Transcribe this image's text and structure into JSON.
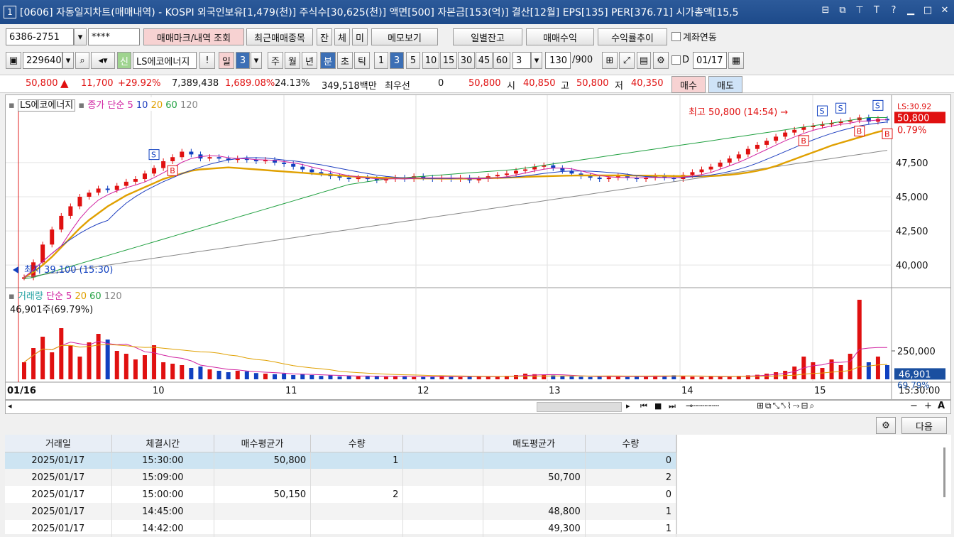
{
  "title": {
    "num": "1",
    "text": "[0606] 자동일지차트(매매내역) - KOSPI 외국인보유[1,479(천)] 주식수[30,625(천)] 액면[500] 자본금[153(억)] 결산[12월] EPS[135] PER[376.71] 시가총액[15,5"
  },
  "toolbar1": {
    "account": "6386-2751",
    "password": "****",
    "btn_trade_mark": "매매마크/내역 조회",
    "btn_recent": "최근매매종목",
    "btn_jan": "잔",
    "btn_che": "체",
    "btn_mi": "미",
    "btn_memo": "메모보기",
    "btn_daily": "일별잔고",
    "btn_profit": "매매수익",
    "btn_return": "수익률추이",
    "check_link": "계좌연동"
  },
  "toolbar2": {
    "code": "229640",
    "name": "LS에코에너지",
    "sin": "신",
    "excl": "!",
    "periods": [
      "일",
      "3",
      "주",
      "월",
      "년",
      "분",
      "초",
      "틱"
    ],
    "mins": [
      "1",
      "3",
      "5",
      "10",
      "15",
      "30",
      "45",
      "60"
    ],
    "count": "3",
    "range": "130",
    "range_total": "/900",
    "d_label": "D",
    "date": "01/17"
  },
  "quote": {
    "price": "50,800",
    "arrow": "▲",
    "change": "11,700",
    "pct": "+29.92%",
    "volume": "7,389,438",
    "vol_pct": "1,689.08%",
    "turnover": "24.13%",
    "amount": "349,518백만",
    "best": "최우선",
    "best_val": "0",
    "best_price": "50,800",
    "open_lbl": "시",
    "open": "40,850",
    "high_lbl": "고",
    "high": "50,800",
    "low_lbl": "저",
    "low": "40,350",
    "buy": "매수",
    "sell": "매도"
  },
  "chart_data": {
    "type": "line",
    "legend": {
      "name": "LS에코에너지",
      "series": "종가 단순",
      "ma": [
        "5",
        "10",
        "20",
        "60",
        "120"
      ]
    },
    "y_ticks": [
      "47,500",
      "45,000",
      "42,500",
      "40,000"
    ],
    "ylim": [
      38500,
      51500
    ],
    "x_labels": [
      "01/16",
      "10",
      "11",
      "12",
      "13",
      "14",
      "15"
    ],
    "max_label": "최고 50,800 (14:54)",
    "min_label": "최저 39,100 (15:30)",
    "price_tag": "50,800",
    "price_pct": "0.79%",
    "cut_label": "LS:30.92",
    "close": [
      39100,
      40200,
      41500,
      42600,
      43600,
      44300,
      45000,
      45300,
      45600,
      45500,
      45800,
      46100,
      46300,
      46700,
      47100,
      47600,
      47900,
      48300,
      48100,
      47800,
      47900,
      47800,
      47700,
      47800,
      47700,
      47600,
      47700,
      47500,
      47400,
      47200,
      47000,
      46800,
      46700,
      46500,
      46400,
      46300,
      46400,
      46300,
      46200,
      46300,
      46400,
      46300,
      46500,
      46400,
      46300,
      46400,
      46300,
      46400,
      46200,
      46300,
      46500,
      46600,
      46700,
      46900,
      47000,
      47200,
      47300,
      47100,
      46900,
      46700,
      46500,
      46400,
      46300,
      46400,
      46500,
      46400,
      46300,
      46400,
      46500,
      46400,
      46300,
      46600,
      46800,
      47000,
      47200,
      47500,
      47800,
      48100,
      48500,
      48800,
      49100,
      49400,
      49700,
      49900,
      50100,
      50200,
      50300,
      50400,
      50500,
      50600,
      50800,
      50500,
      50700,
      50600
    ],
    "ma20": [
      39100,
      39500,
      40000,
      40600,
      41300,
      42000,
      42700,
      43300,
      43800,
      44300,
      44700,
      45100,
      45400,
      45700,
      46000,
      46300,
      46500,
      46700,
      46900,
      47000,
      47050,
      47100,
      47150,
      47100,
      47050,
      47000,
      46950,
      46900,
      46850,
      46800,
      46750,
      46700,
      46650,
      46600,
      46550,
      46500,
      46450,
      46420,
      46400,
      46380,
      46370,
      46360,
      46350,
      46340,
      46340,
      46330,
      46330,
      46330,
      46330,
      46340,
      46360,
      46380,
      46400,
      46420,
      46450,
      46480,
      46500,
      46520,
      46540,
      46550,
      46560,
      46560,
      46560,
      46560,
      46560,
      46560,
      46550,
      46550,
      46540,
      46530,
      46520,
      46510,
      46500,
      46500,
      46520,
      46550,
      46600,
      46680,
      46780,
      46900,
      47050,
      47250,
      47500,
      47750,
      48000,
      48250,
      48500,
      48750,
      48950,
      49150,
      49350,
      49550,
      49750,
      49900
    ],
    "ma60": [
      39000,
      39100,
      39300,
      39500,
      39700,
      39900,
      40100,
      40300,
      40500,
      40700,
      40900,
      41100,
      41300,
      41500,
      41700,
      41900,
      42100,
      42300,
      42500,
      42700,
      42900,
      43100,
      43300,
      43500,
      43700,
      43900,
      44100,
      44300,
      44500,
      44700,
      44900,
      45100,
      45300,
      45500,
      45700,
      45900,
      46000,
      46100,
      46200,
      46300,
      46350,
      46400,
      46450,
      46500,
      46550,
      46600,
      46650,
      46700,
      46750,
      46800,
      46850,
      46900,
      46950,
      47000,
      47100,
      47200,
      47300,
      47400,
      47500,
      47600,
      47700,
      47800,
      47900,
      48000,
      48100,
      48200,
      48300,
      48400,
      48500,
      48600,
      48700,
      48800,
      48900,
      49000,
      49100,
      49200,
      49300,
      49400,
      49500,
      49600,
      49700,
      49800,
      49900,
      50000,
      50100,
      50200,
      50300,
      50400,
      50500,
      50600,
      50700,
      50800,
      50800,
      50800
    ],
    "ma120": [
      39100,
      39200,
      39300,
      39400,
      39500,
      39600,
      39700,
      39800,
      39900,
      40000,
      40100,
      40200,
      40300,
      40400,
      40500,
      40600,
      40700,
      40800,
      40900,
      41000,
      41100,
      41200,
      41300,
      41400,
      41500,
      41600,
      41700,
      41800,
      41900,
      42000,
      42100,
      42200,
      42300,
      42400,
      42500,
      42600,
      42700,
      42800,
      42900,
      43000,
      43100,
      43200,
      43300,
      43400,
      43500,
      43600,
      43700,
      43800,
      43900,
      44000,
      44100,
      44200,
      44300,
      44400,
      44500,
      44600,
      44700,
      44800,
      44900,
      45000,
      45100,
      45200,
      45300,
      45400,
      45500,
      45600,
      45700,
      45800,
      45900,
      46000,
      46100,
      46200,
      46300,
      46400,
      46500,
      46600,
      46700,
      46800,
      46900,
      47000,
      47100,
      47200,
      47300,
      47400,
      47500,
      47600,
      47700,
      47800,
      47900,
      48000,
      48100,
      48200,
      48300,
      48400
    ],
    "volume_legend": {
      "name": "거래량",
      "series": "단순",
      "ma": [
        "5",
        "20",
        "60",
        "120"
      ],
      "value": "46,901주(69.79%)"
    },
    "volume_tick": "250,000",
    "volume_tag": "46,901",
    "volume_pct": "69.79%",
    "volume": [
      60,
      110,
      150,
      95,
      180,
      120,
      80,
      130,
      160,
      140,
      100,
      90,
      70,
      85,
      120,
      60,
      55,
      50,
      40,
      45,
      35,
      30,
      25,
      30,
      28,
      22,
      20,
      18,
      20,
      15,
      18,
      15,
      12,
      14,
      10,
      12,
      10,
      11,
      12,
      9,
      10,
      11,
      8,
      9,
      10,
      12,
      9,
      8,
      10,
      11,
      9,
      10,
      12,
      15,
      20,
      18,
      16,
      14,
      12,
      10,
      9,
      8,
      10,
      12,
      9,
      8,
      10,
      9,
      11,
      12,
      14,
      10,
      9,
      8,
      10,
      9,
      11,
      12,
      14,
      16,
      20,
      25,
      30,
      45,
      80,
      60,
      40,
      70,
      50,
      90,
      280,
      60,
      80,
      50
    ],
    "time_label": "15:30:00"
  },
  "grid": {
    "headers": [
      "거래일",
      "체결시간",
      "매수평균가",
      "수량",
      "",
      "매도평균가",
      "수량"
    ],
    "rows": [
      [
        "2025/01/17",
        "15:30:00",
        "50,800",
        "1",
        "",
        "",
        "0"
      ],
      [
        "2025/01/17",
        "15:09:00",
        "",
        "",
        "",
        "50,700",
        "2"
      ],
      [
        "2025/01/17",
        "15:00:00",
        "50,150",
        "2",
        "",
        "",
        "0"
      ],
      [
        "2025/01/17",
        "14:45:00",
        "",
        "",
        "",
        "48,800",
        "1"
      ],
      [
        "2025/01/17",
        "14:42:00",
        "",
        "",
        "",
        "49,300",
        "1"
      ]
    ],
    "next": "다음"
  }
}
